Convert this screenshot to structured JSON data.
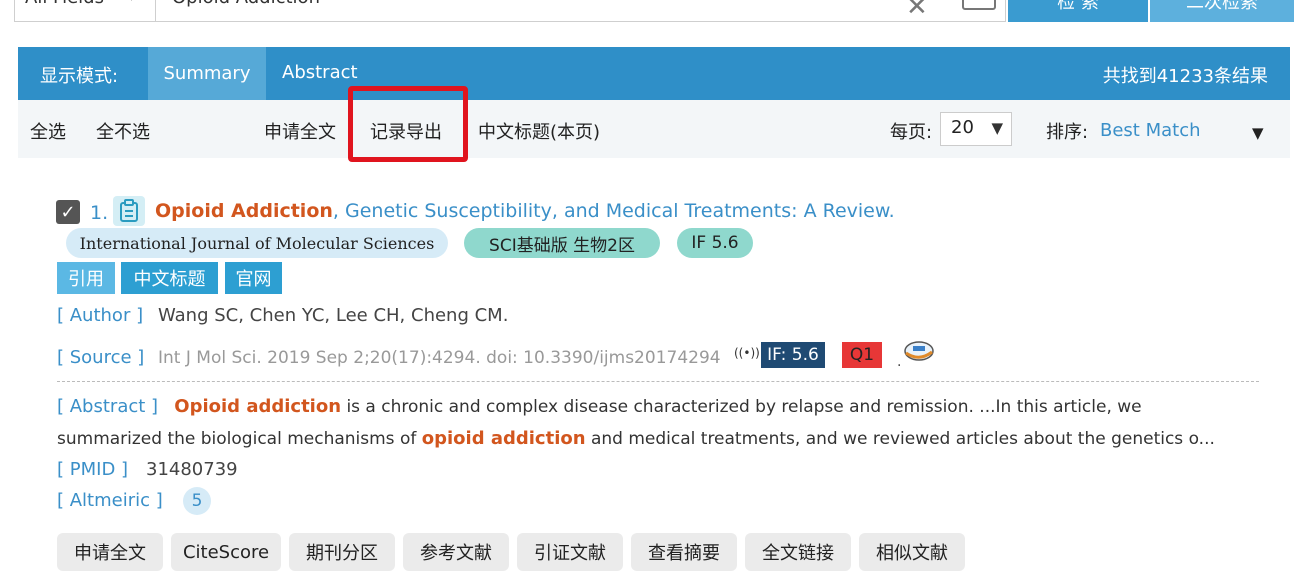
{
  "search": {
    "field": "All Fields",
    "query": "Opioid Addiction",
    "search_button": "检 索",
    "advanced_button": "二次检索"
  },
  "header": {
    "display_mode_label": "显示模式:",
    "tabs": [
      {
        "label": "Summary"
      },
      {
        "label": "Abstract"
      }
    ],
    "result_count": "共找到41233条结果"
  },
  "toolbar": {
    "select_all": "全选",
    "select_none": "全不选",
    "request_fulltext": "申请全文",
    "export_records": "记录导出",
    "chinese_title": "中文标题(本页)",
    "per_page_label": "每页:",
    "per_page_value": "20",
    "sort_label": "排序:",
    "sort_value": "Best Match"
  },
  "result": {
    "number": "1.",
    "title_highlight": "Opioid Addiction",
    "title_rest": ", Genetic Susceptibility, and Medical Treatments: A Review.",
    "journal": "International Journal of Molecular Sciences",
    "sci_badge": "SCI基础版 生物2区",
    "if_badge": "IF 5.6",
    "buttons": {
      "cite": "引用",
      "chinese_title": "中文标题",
      "official": "官网"
    },
    "author_label": "[ Author ]",
    "authors": "Wang SC, Chen YC, Lee CH, Cheng CM.",
    "source_label": "[ Source ]",
    "source": "Int J Mol Sci. 2019 Sep 2;20(17):4294. doi: 10.3390/ijms20174294",
    "if_tag": "IF: 5.6",
    "quartile": "Q1",
    "abstract_label": "[ Abstract ]",
    "abstract_hl1": "Opioid addiction",
    "abstract_part1": " is a chronic and complex disease characterized by relapse and remission. ...In this article, we",
    "abstract_part2a": "summarized the biological mechanisms of ",
    "abstract_hl2": "opioid addiction",
    "abstract_part2b": " and medical treatments, and we reviewed articles about the genetics o...",
    "pmid_label": "[ PMID ]",
    "pmid": "31480739",
    "altmetric_label": "[ Altmeiric ]",
    "altmetric": "5",
    "bottom_buttons": [
      "申请全文",
      "CiteScore",
      "期刊分区",
      "参考文献",
      "引证文献",
      "查看摘要",
      "全文链接",
      "相似文献"
    ]
  }
}
